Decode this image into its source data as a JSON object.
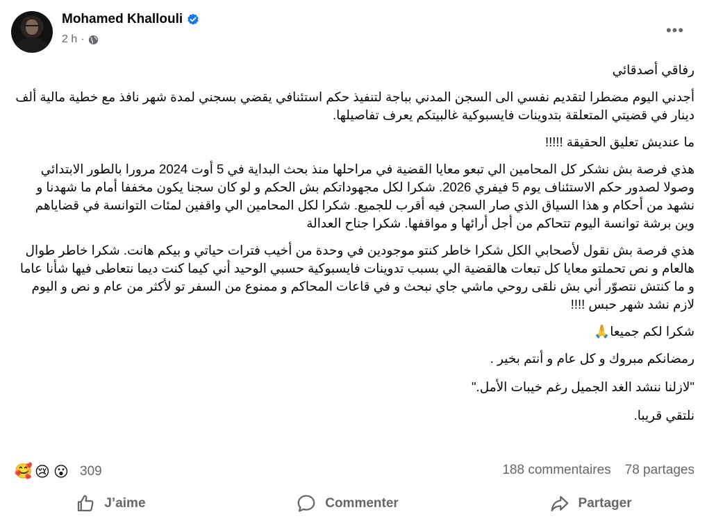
{
  "author": {
    "name": "Mohamed Khallouli",
    "verified_icon": "verified-badge-icon",
    "verified_color": "#1877f2"
  },
  "meta": {
    "time": "2 h",
    "separator": "·",
    "audience_icon": "globe-icon"
  },
  "menu": {
    "more_label": "•••"
  },
  "post": {
    "paragraphs": [
      "رفاقي أصدقائي",
      "أجدني اليوم مضطرا لتقديم نفسي الى السجن المدني بباجة  لتنفيذ حكم استئنافي يقضي بسجني لمدة شهر نافذ مع خطية مالية ألف دينار في قضيتي المتعلقة بتدوينات فايسبوكية غالبيتكم يعرف تفاصيلها.",
      "ما عنديش تعليق الحقيقة !!!!!",
      "هذي فرصة بش نشكر كل المحامين الي تبعو معايا القضية في مراحلها منذ بحث البداية في 5 أوت 2024 مرورا بالطور الابتدائي وصولا لصدور حكم الاستئناف يوم 5 فيفري 2026. شكرا لكل مجهوداتكم بش الحكم و لو كان سجنا يكون مخففا أمام ما شهدنا و نشهد من أحكام و هذا السياق الذي صار السجن فيه أقرب للجميع. شكرا لكل المحامين الي واقفين لمئات التوانسة في قضاياهم وين برشة توانسة اليوم تتحاكم من أجل أرائها و مواقفها. شكرا جناح العدالة",
      "هذي فرصة بش نقول لأصحابي الكل شكرا خاطر كنتو موجودين في وحدة من أخيب فترات حياتي و بيكم هانت. شكرا خاطر طوال هالعام و نص تحملتو معايا كل تبعات هالقضية الي بسبب تدوينات فايسبوكية حسبي الوحيد أني كيما كنت ديما نتعاطى فيها شأنا عاما و ما كنتش نتصوّر أني بش نلقى روحي ماشي جاي نبحث و في قاعات المحاكم و ممنوع من السفر تو لأكثر من عام و نص و اليوم لازم نشد شهر حبس !!!!",
      "شكرا لكم جميعا🙏",
      "رمضانكم مبروك و كل عام و أنتم بخير .",
      "\"لازلنا ننشد الغد الجميل رغم خيبات الأمل.\"",
      "نلتقي قريبا."
    ]
  },
  "reactions": {
    "emojis": [
      "🥰",
      "😢",
      "😮"
    ],
    "count": "309"
  },
  "stats": {
    "comments": "188 commentaires",
    "shares": "78 partages"
  },
  "actions": {
    "like": "J’aime",
    "comment": "Commenter",
    "share": "Partager"
  },
  "colors": {
    "text_primary": "#050505",
    "text_secondary": "#65676b",
    "background": "#ffffff"
  }
}
